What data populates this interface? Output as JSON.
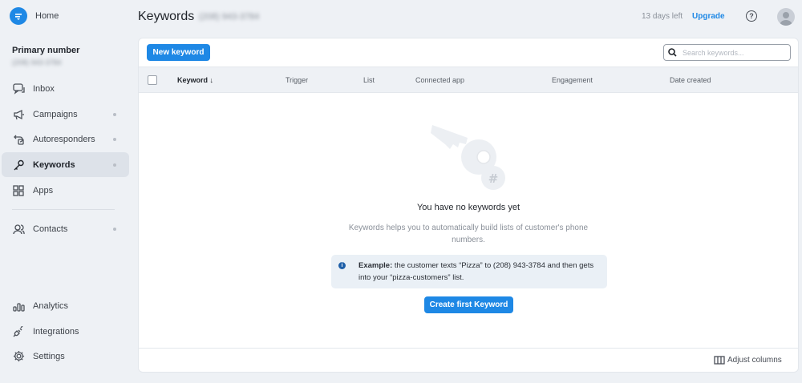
{
  "sidebar": {
    "brand": "Home",
    "primary_title": "Primary number",
    "primary_number": "(208) 943-3784",
    "items": [
      {
        "label": "Inbox",
        "icon": "inbox-icon"
      },
      {
        "label": "Campaigns",
        "icon": "megaphone-icon"
      },
      {
        "label": "Autoresponders",
        "icon": "autoresponder-icon"
      },
      {
        "label": "Keywords",
        "icon": "key-icon"
      },
      {
        "label": "Apps",
        "icon": "apps-grid-icon"
      },
      {
        "label": "Contacts",
        "icon": "contacts-icon"
      },
      {
        "label": "Analytics",
        "icon": "analytics-icon"
      },
      {
        "label": "Integrations",
        "icon": "plug-icon"
      },
      {
        "label": "Settings",
        "icon": "gear-icon"
      }
    ],
    "active": "Keywords"
  },
  "header": {
    "title": "Keywords",
    "phone": "(208) 943-3784",
    "trial": "13 days left",
    "upgrade": "Upgrade",
    "help": "?"
  },
  "toolbar": {
    "new_keyword": "New keyword",
    "search_placeholder": "Search keywords..."
  },
  "table": {
    "columns": [
      "Keyword",
      "Trigger",
      "List",
      "Connected app",
      "Engagement",
      "Date created"
    ],
    "sort_column": "Keyword",
    "sort_direction": "desc"
  },
  "empty_state": {
    "title": "You have no keywords yet",
    "description": "Keywords helps you to automatically build lists of customer's phone numbers.",
    "example_label": "Example:",
    "example_text": "the customer texts “Pizza” to (208) 943-3784 and then gets into your “pizza-customers” list.",
    "cta": "Create first Keyword"
  },
  "footer": {
    "adjust_columns": "Adjust columns"
  },
  "colors": {
    "accent": "#1e88e5",
    "background": "#eef1f5",
    "active_nav": "#dde2e9"
  }
}
